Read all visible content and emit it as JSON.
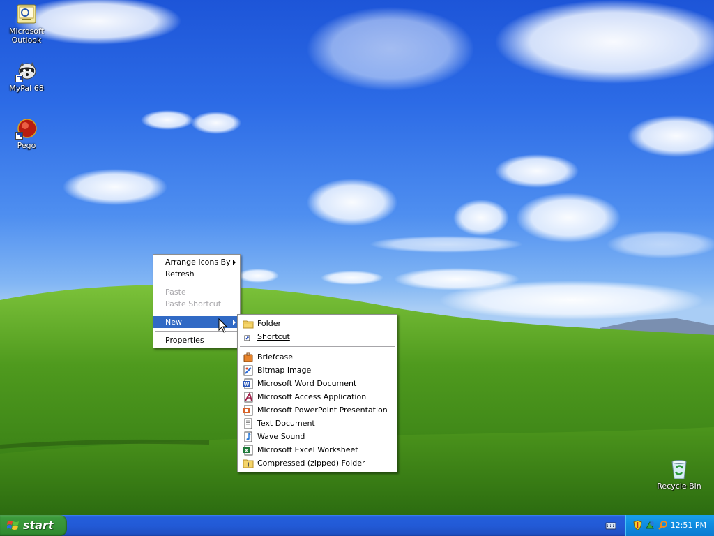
{
  "desktop": {
    "icons": [
      {
        "label_line1": "Microsoft",
        "label_line2": "Outlook",
        "icon": "outlook-icon"
      },
      {
        "label_line1": "MyPal 68",
        "icon": "mypal-icon"
      },
      {
        "label_line1": "Pego",
        "icon": "pego-icon"
      },
      {
        "label_line1": "Recycle Bin",
        "icon": "recycle-bin-icon"
      }
    ]
  },
  "context_menu": {
    "items": [
      {
        "label": "Arrange Icons By",
        "has_submenu": true
      },
      {
        "label": "Refresh"
      },
      {
        "label": "Paste",
        "disabled": true
      },
      {
        "label": "Paste Shortcut",
        "disabled": true
      },
      {
        "label": "New",
        "has_submenu": true,
        "active": true
      },
      {
        "label": "Properties"
      }
    ]
  },
  "new_submenu": {
    "items": [
      {
        "label": "Folder",
        "icon": "folder-icon"
      },
      {
        "label": "Shortcut",
        "icon": "shortcut-icon"
      },
      {
        "label": "Briefcase",
        "icon": "briefcase-icon"
      },
      {
        "label": "Bitmap Image",
        "icon": "bitmap-icon"
      },
      {
        "label": "Microsoft Word Document",
        "icon": "word-icon"
      },
      {
        "label": "Microsoft Access Application",
        "icon": "access-icon"
      },
      {
        "label": "Microsoft PowerPoint Presentation",
        "icon": "powerpoint-icon"
      },
      {
        "label": "Text Document",
        "icon": "text-document-icon"
      },
      {
        "label": "Wave Sound",
        "icon": "wave-sound-icon"
      },
      {
        "label": "Microsoft Excel Worksheet",
        "icon": "excel-icon"
      },
      {
        "label": "Compressed (zipped) Folder",
        "icon": "zip-folder-icon"
      }
    ]
  },
  "taskbar": {
    "start_label": "start",
    "clock": "12:51 PM"
  },
  "colors": {
    "menu_highlight": "#316ac5",
    "taskbar_blue": "#245edb",
    "start_green": "#379437",
    "tray_blue": "#0f8be0"
  }
}
